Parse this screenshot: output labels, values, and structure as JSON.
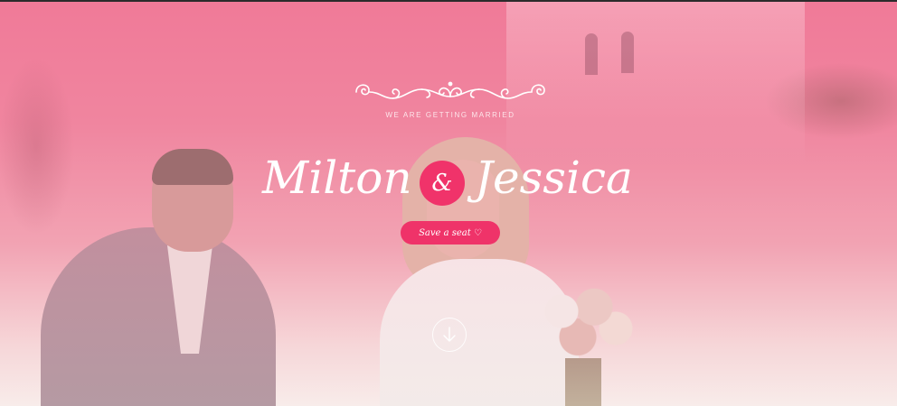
{
  "hero": {
    "subtitle": "WE ARE GETTING MARRIED",
    "name_left": "Milton",
    "ampersand": "&",
    "name_right": "Jessica",
    "cta_label": "Save a seat ♡",
    "ornament_icon": "flourish-ornament",
    "scroll_icon": "arrow-down-circle"
  },
  "colors": {
    "accent": "#ef3369",
    "overlay": "#f07a98"
  }
}
